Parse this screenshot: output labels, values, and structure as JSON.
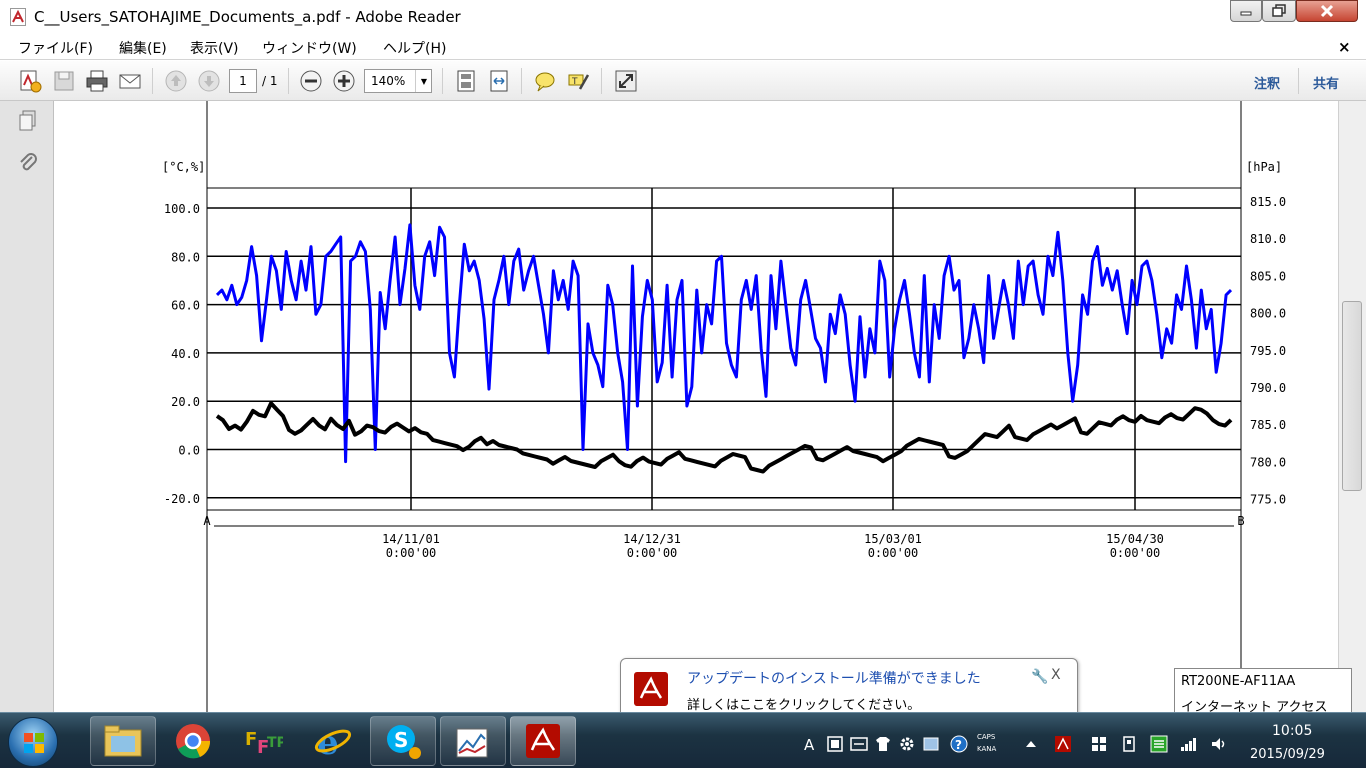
{
  "window": {
    "title": "C__Users_SATOHAJIME_Documents_a.pdf - Adobe Reader"
  },
  "menu": {
    "items": [
      "ファイル(F)",
      "編集(E)",
      "表示(V)",
      "ウィンドウ(W)",
      "ヘルプ(H)"
    ],
    "close_glyph": "×"
  },
  "toolbar": {
    "page_current": "1",
    "page_total": "/ 1",
    "zoom": "140%",
    "comment_label": "注釈",
    "share_label": "共有"
  },
  "icons": {
    "app": "adobe-reader-icon",
    "create": "create-pdf-icon",
    "save": "save-icon",
    "print": "print-icon",
    "email": "email-icon",
    "prev": "prev-page-icon",
    "next": "next-page-icon",
    "zoom_out": "zoom-out-icon",
    "zoom_in": "zoom-in-icon",
    "fit_page": "fit-page-icon",
    "fit_width": "fit-width-icon",
    "comment": "comment-icon",
    "highlight": "highlight-icon",
    "fullscreen": "fullscreen-icon",
    "pages": "pages-panel-icon",
    "attachments": "attachments-icon"
  },
  "colors": {
    "series_humidity": "#0000ff",
    "series_temperature": "#000000",
    "accent": "#2c5a9a"
  },
  "chart_data": {
    "type": "line",
    "left_axis_unit": "[°C,%]",
    "right_axis_unit": "[hPa]",
    "left_ticks": [
      "100.0",
      "80.0",
      "60.0",
      "40.0",
      "20.0",
      "0.0",
      "-20.0"
    ],
    "right_ticks": [
      "815.0",
      "810.0",
      "805.0",
      "800.0",
      "795.0",
      "790.0",
      "785.0",
      "780.0",
      "775.0"
    ],
    "ylim_left": [
      -20,
      100
    ],
    "ylim_right": [
      775,
      815
    ],
    "x_start_label": "A",
    "x_end_label": "B",
    "x_ticks": [
      {
        "date": "14/11/01",
        "time": "0:00'00"
      },
      {
        "date": "14/12/31",
        "time": "0:00'00"
      },
      {
        "date": "15/03/01",
        "time": "0:00'00"
      },
      {
        "date": "15/04/30",
        "time": "0:00'00"
      }
    ],
    "x_range": [
      "14/09/18",
      "15/06/12"
    ],
    "grid": true,
    "series": [
      {
        "color": "#0000ff",
        "values": [
          64,
          66,
          62,
          68,
          60,
          63,
          70,
          84,
          72,
          45,
          62,
          80,
          74,
          58,
          82,
          70,
          62,
          78,
          66,
          84,
          56,
          60,
          80,
          82,
          85,
          88,
          -5,
          78,
          80,
          86,
          82,
          58,
          0,
          65,
          50,
          70,
          88,
          60,
          75,
          93,
          68,
          58,
          80,
          86,
          72,
          92,
          88,
          40,
          30,
          60,
          85,
          74,
          78,
          70,
          54,
          25,
          62,
          70,
          80,
          60,
          78,
          83,
          66,
          74,
          80,
          68,
          56,
          40,
          74,
          62,
          70,
          58,
          78,
          72,
          0,
          52,
          40,
          35,
          26,
          68,
          60,
          40,
          28,
          0,
          76,
          18,
          55,
          70,
          62,
          28,
          36,
          68,
          30,
          62,
          70,
          18,
          26,
          66,
          40,
          60,
          52,
          78,
          80,
          44,
          35,
          30,
          62,
          70,
          58,
          72,
          42,
          22,
          72,
          50,
          78,
          60,
          42,
          35,
          62,
          70,
          58,
          46,
          42,
          28,
          56,
          48,
          64,
          56,
          35,
          20,
          55,
          30,
          50,
          40,
          78,
          70,
          30,
          50,
          62,
          70,
          56,
          40,
          30,
          72,
          28,
          60,
          46,
          72,
          80,
          66,
          70,
          38,
          46,
          60,
          50,
          36,
          72,
          46,
          58,
          70,
          60,
          46,
          78,
          60,
          76,
          78,
          64,
          56,
          80,
          72,
          90,
          70,
          40,
          20,
          35,
          64,
          56,
          78,
          84,
          68,
          75,
          66,
          74,
          60,
          48,
          70,
          60,
          76,
          78,
          70,
          56,
          38,
          50,
          44,
          64,
          58,
          76,
          62,
          42,
          66,
          50,
          58,
          32,
          44,
          64,
          66
        ],
        "x_frac_note": ""
      },
      {
        "color": "#000000",
        "values": [
          12,
          14,
          10,
          11,
          9,
          12,
          16,
          14,
          13,
          18,
          15,
          12,
          10,
          8,
          9,
          11,
          13,
          10,
          8,
          12,
          9,
          7,
          10,
          8,
          9,
          11,
          10,
          8,
          7,
          9,
          10,
          8,
          6,
          7,
          9,
          8,
          5,
          4,
          3,
          2,
          1,
          -1,
          0,
          2,
          3,
          4,
          5,
          3,
          2,
          1,
          0,
          -2,
          -3,
          -4,
          -5,
          -6,
          -4,
          -3,
          -2,
          -4,
          -5,
          -6,
          -7,
          -8,
          -6,
          -5,
          -4,
          -3,
          -5,
          -6,
          -4,
          -3,
          -5,
          -6,
          -7,
          -5,
          -4,
          -3,
          -2,
          -3,
          -4,
          -5,
          -6,
          -7,
          -5,
          -4,
          -3,
          -4,
          -5,
          -6,
          -7,
          -8,
          -6,
          -5,
          -4,
          -3,
          -2,
          -1,
          0,
          -1,
          -2,
          -3,
          -2,
          -1,
          0,
          1,
          -1,
          -2,
          -3,
          -4,
          -5,
          -3,
          -2,
          -1,
          0,
          2,
          3,
          4,
          3,
          2,
          1,
          0,
          -1,
          -2,
          -1,
          0,
          2,
          4,
          6,
          5,
          4,
          6,
          8,
          7,
          6,
          5,
          7,
          8,
          9,
          10,
          8,
          9,
          10,
          11,
          9,
          8,
          10,
          12,
          11,
          10,
          12,
          13,
          11,
          10,
          12,
          14,
          13,
          12,
          14,
          15,
          13,
          12,
          14,
          16,
          15,
          13,
          14,
          12,
          11,
          13
        ]
      }
    ]
  },
  "taskbar": {
    "caps": "CAPS",
    "kana": "KANA",
    "time": "10:05",
    "date": "2015/09/29"
  },
  "notification": {
    "title": "アップデートのインストール準備ができました",
    "body": "詳しくはここをクリックしてください。",
    "close_glyph": "X"
  },
  "tooltip": {
    "line1": "RT200NE-AF11AA",
    "line2": "インターネット アクセス"
  }
}
